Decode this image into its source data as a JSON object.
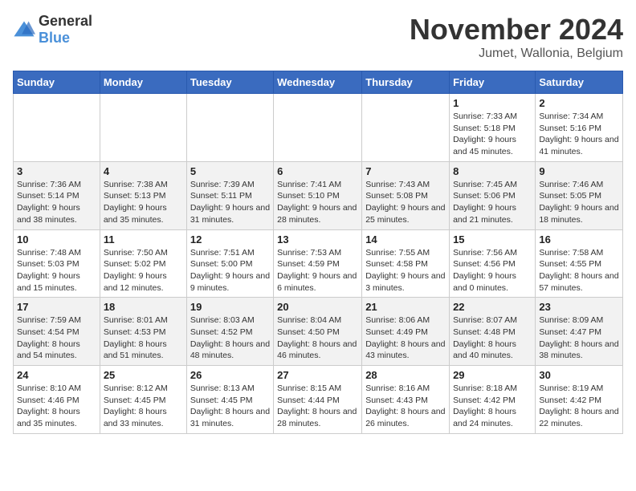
{
  "logo": {
    "general": "General",
    "blue": "Blue"
  },
  "header": {
    "month": "November 2024",
    "location": "Jumet, Wallonia, Belgium"
  },
  "days_of_week": [
    "Sunday",
    "Monday",
    "Tuesday",
    "Wednesday",
    "Thursday",
    "Friday",
    "Saturday"
  ],
  "weeks": [
    [
      {
        "day": "",
        "info": ""
      },
      {
        "day": "",
        "info": ""
      },
      {
        "day": "",
        "info": ""
      },
      {
        "day": "",
        "info": ""
      },
      {
        "day": "",
        "info": ""
      },
      {
        "day": "1",
        "info": "Sunrise: 7:33 AM\nSunset: 5:18 PM\nDaylight: 9 hours and 45 minutes."
      },
      {
        "day": "2",
        "info": "Sunrise: 7:34 AM\nSunset: 5:16 PM\nDaylight: 9 hours and 41 minutes."
      }
    ],
    [
      {
        "day": "3",
        "info": "Sunrise: 7:36 AM\nSunset: 5:14 PM\nDaylight: 9 hours and 38 minutes."
      },
      {
        "day": "4",
        "info": "Sunrise: 7:38 AM\nSunset: 5:13 PM\nDaylight: 9 hours and 35 minutes."
      },
      {
        "day": "5",
        "info": "Sunrise: 7:39 AM\nSunset: 5:11 PM\nDaylight: 9 hours and 31 minutes."
      },
      {
        "day": "6",
        "info": "Sunrise: 7:41 AM\nSunset: 5:10 PM\nDaylight: 9 hours and 28 minutes."
      },
      {
        "day": "7",
        "info": "Sunrise: 7:43 AM\nSunset: 5:08 PM\nDaylight: 9 hours and 25 minutes."
      },
      {
        "day": "8",
        "info": "Sunrise: 7:45 AM\nSunset: 5:06 PM\nDaylight: 9 hours and 21 minutes."
      },
      {
        "day": "9",
        "info": "Sunrise: 7:46 AM\nSunset: 5:05 PM\nDaylight: 9 hours and 18 minutes."
      }
    ],
    [
      {
        "day": "10",
        "info": "Sunrise: 7:48 AM\nSunset: 5:03 PM\nDaylight: 9 hours and 15 minutes."
      },
      {
        "day": "11",
        "info": "Sunrise: 7:50 AM\nSunset: 5:02 PM\nDaylight: 9 hours and 12 minutes."
      },
      {
        "day": "12",
        "info": "Sunrise: 7:51 AM\nSunset: 5:00 PM\nDaylight: 9 hours and 9 minutes."
      },
      {
        "day": "13",
        "info": "Sunrise: 7:53 AM\nSunset: 4:59 PM\nDaylight: 9 hours and 6 minutes."
      },
      {
        "day": "14",
        "info": "Sunrise: 7:55 AM\nSunset: 4:58 PM\nDaylight: 9 hours and 3 minutes."
      },
      {
        "day": "15",
        "info": "Sunrise: 7:56 AM\nSunset: 4:56 PM\nDaylight: 9 hours and 0 minutes."
      },
      {
        "day": "16",
        "info": "Sunrise: 7:58 AM\nSunset: 4:55 PM\nDaylight: 8 hours and 57 minutes."
      }
    ],
    [
      {
        "day": "17",
        "info": "Sunrise: 7:59 AM\nSunset: 4:54 PM\nDaylight: 8 hours and 54 minutes."
      },
      {
        "day": "18",
        "info": "Sunrise: 8:01 AM\nSunset: 4:53 PM\nDaylight: 8 hours and 51 minutes."
      },
      {
        "day": "19",
        "info": "Sunrise: 8:03 AM\nSunset: 4:52 PM\nDaylight: 8 hours and 48 minutes."
      },
      {
        "day": "20",
        "info": "Sunrise: 8:04 AM\nSunset: 4:50 PM\nDaylight: 8 hours and 46 minutes."
      },
      {
        "day": "21",
        "info": "Sunrise: 8:06 AM\nSunset: 4:49 PM\nDaylight: 8 hours and 43 minutes."
      },
      {
        "day": "22",
        "info": "Sunrise: 8:07 AM\nSunset: 4:48 PM\nDaylight: 8 hours and 40 minutes."
      },
      {
        "day": "23",
        "info": "Sunrise: 8:09 AM\nSunset: 4:47 PM\nDaylight: 8 hours and 38 minutes."
      }
    ],
    [
      {
        "day": "24",
        "info": "Sunrise: 8:10 AM\nSunset: 4:46 PM\nDaylight: 8 hours and 35 minutes."
      },
      {
        "day": "25",
        "info": "Sunrise: 8:12 AM\nSunset: 4:45 PM\nDaylight: 8 hours and 33 minutes."
      },
      {
        "day": "26",
        "info": "Sunrise: 8:13 AM\nSunset: 4:45 PM\nDaylight: 8 hours and 31 minutes."
      },
      {
        "day": "27",
        "info": "Sunrise: 8:15 AM\nSunset: 4:44 PM\nDaylight: 8 hours and 28 minutes."
      },
      {
        "day": "28",
        "info": "Sunrise: 8:16 AM\nSunset: 4:43 PM\nDaylight: 8 hours and 26 minutes."
      },
      {
        "day": "29",
        "info": "Sunrise: 8:18 AM\nSunset: 4:42 PM\nDaylight: 8 hours and 24 minutes."
      },
      {
        "day": "30",
        "info": "Sunrise: 8:19 AM\nSunset: 4:42 PM\nDaylight: 8 hours and 22 minutes."
      }
    ]
  ]
}
